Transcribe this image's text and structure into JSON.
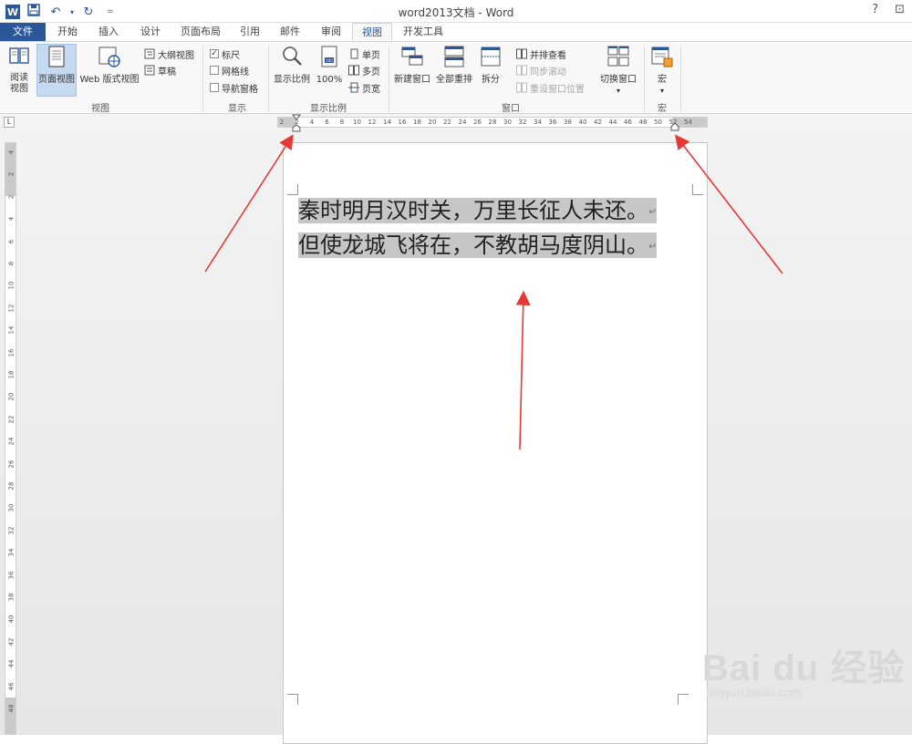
{
  "title": "word2013文档 - Word",
  "window_controls": {
    "help": "?",
    "ribbon_options": "⊡"
  },
  "tabs": [
    "文件",
    "开始",
    "插入",
    "设计",
    "页面布局",
    "引用",
    "邮件",
    "审阅",
    "视图",
    "开发工具"
  ],
  "active_tab": "视图",
  "ribbon": {
    "views": {
      "read_mode": "阅读\n视图",
      "print_layout": "页面视图",
      "web_layout": "Web 版式视图",
      "outline": "大纲视图",
      "draft": "草稿",
      "group": "视图"
    },
    "show": {
      "ruler": "标尺",
      "gridlines": "网格线",
      "nav_pane": "导航窗格",
      "group": "显示",
      "ruler_checked": true
    },
    "zoom": {
      "zoom": "显示比例",
      "hundred": "100%",
      "one_page": "单页",
      "multi_page": "多页",
      "page_width": "页宽",
      "group": "显示比例"
    },
    "window": {
      "new_window": "新建窗口",
      "arrange_all": "全部重排",
      "split": "拆分",
      "side_by_side": "并排查看",
      "sync_scroll": "同步滚动",
      "reset_pos": "重设窗口位置",
      "switch": "切换窗口",
      "group": "窗口"
    },
    "macros": {
      "macros": "宏",
      "group": "宏"
    }
  },
  "ruler_h": [
    "2",
    "2",
    "4",
    "6",
    "8",
    "10",
    "12",
    "14",
    "16",
    "18",
    "20",
    "22",
    "24",
    "26",
    "28",
    "30",
    "32",
    "34",
    "36",
    "38",
    "40",
    "42",
    "44",
    "46",
    "48",
    "50",
    "52",
    "54"
  ],
  "ruler_v": [
    "4",
    "2",
    "2",
    "4",
    "6",
    "8",
    "10",
    "12",
    "14",
    "16",
    "18",
    "20",
    "22",
    "24",
    "26",
    "28",
    "30",
    "32",
    "34",
    "36",
    "38",
    "40",
    "42",
    "44",
    "46",
    "48"
  ],
  "document": {
    "line1": "秦时明月汉时关，万里长征人未还。",
    "line2": "但使龙城飞将在，不教胡马度阴山。",
    "para_mark": "↵"
  },
  "watermark": {
    "brand": "Bai du 经验",
    "url": "jingyan.baidu.com"
  },
  "colors": {
    "word_blue": "#2b579a",
    "annotation_arrow": "#e53935"
  }
}
